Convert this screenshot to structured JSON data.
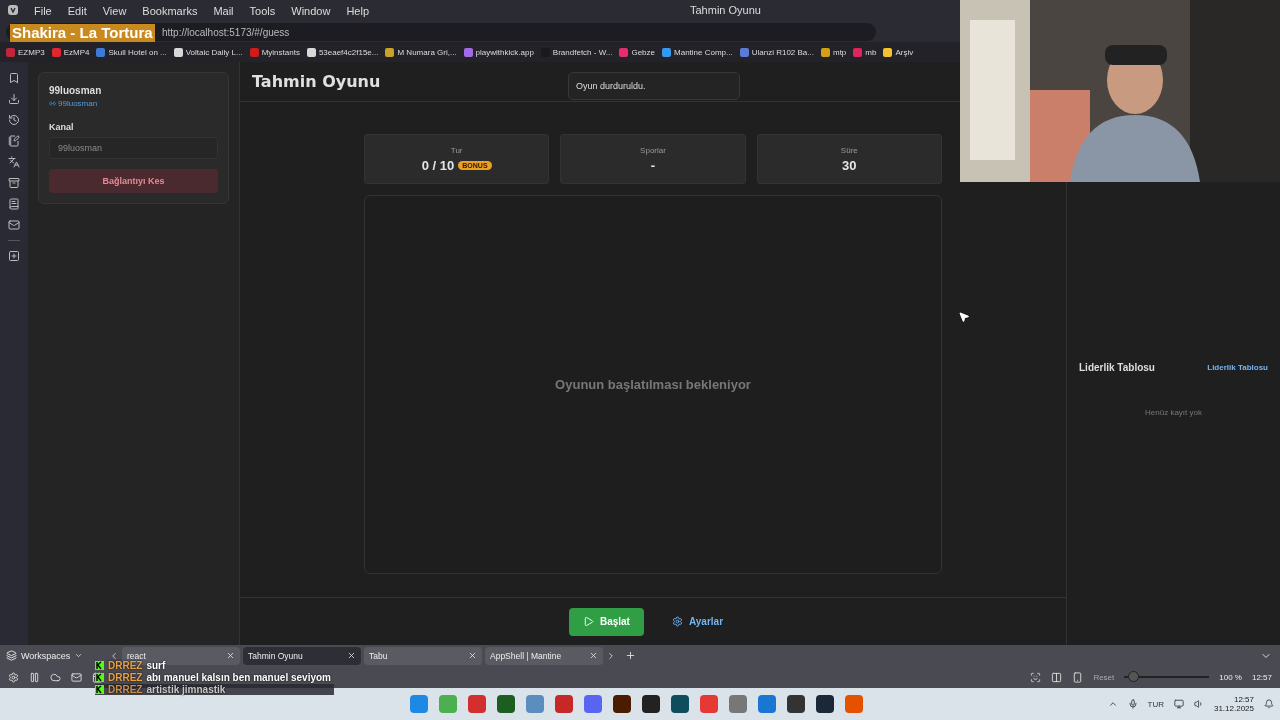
{
  "window": {
    "title": "Tahmin Oyunu"
  },
  "menu": [
    "File",
    "Edit",
    "View",
    "Bookmarks",
    "Mail",
    "Tools",
    "Window",
    "Help"
  ],
  "now_playing": "Shakira - La Tortura",
  "address": "http://localhost:5173/#/guess",
  "bookmarks": [
    {
      "label": "EZMP3",
      "color": "#c0263a"
    },
    {
      "label": "EzMP4",
      "color": "#e0262e"
    },
    {
      "label": "Skull Hotel on ...",
      "color": "#3d7bd6"
    },
    {
      "label": "Voltaic Daily L...",
      "color": "#d8d8d8"
    },
    {
      "label": "Myinstants",
      "color": "#d11a1a"
    },
    {
      "label": "53eaef4c2f15e...",
      "color": "#d8d8d8"
    },
    {
      "label": "M Numara Gri,...",
      "color": "#c9a227"
    },
    {
      "label": "playwithkick.app",
      "color": "#a16be8"
    },
    {
      "label": "Brandfetch - W...",
      "color": "#1a1a1a"
    },
    {
      "label": "Gebze",
      "color": "#e1306c"
    },
    {
      "label": "Mantine Comp...",
      "color": "#339af0"
    },
    {
      "label": "Ulanzi R102 Ba...",
      "color": "#5a7bd6"
    },
    {
      "label": "mtp",
      "color": "#d4a017"
    },
    {
      "label": "mb",
      "color": "#e0245e"
    },
    {
      "label": "Arşiv",
      "color": "#f2c230"
    }
  ],
  "connection": {
    "user": "99luosman",
    "link": "99luosman",
    "label": "Kanal",
    "placeholder": "99luosman",
    "button": "Bağlantıyı Kes"
  },
  "game": {
    "title": "Tahmin Oyunu",
    "toast": "Oyun durduruldu.",
    "stats": [
      {
        "label": "Tur",
        "value": "0 / 10",
        "badge": "BONUS"
      },
      {
        "label": "Sporlar",
        "value": "-"
      },
      {
        "label": "Süre",
        "value": "30"
      }
    ],
    "message": "Oyunun başlatılması bekleniyor",
    "actions": [
      {
        "label": "Başlat",
        "kind": "primary"
      },
      {
        "label": "Ayarlar",
        "kind": "subtle"
      }
    ]
  },
  "leaderboard": {
    "title": "Liderlik Tablosu",
    "link": "Liderlik Tablosu",
    "empty": "Henüz kayıt yok"
  },
  "tab_bar": {
    "workspaces": "Workspaces",
    "tabs": [
      {
        "label": "react",
        "selected": false
      },
      {
        "label": "Tahmin Oyunu",
        "selected": true
      },
      {
        "label": "Tabu",
        "selected": false
      },
      {
        "label": "AppShell | Mantine",
        "selected": false
      }
    ]
  },
  "status_bar": {
    "reset": "Reset",
    "zoom": {
      "level": 0.1
    },
    "zoom_reading": "100 %",
    "clock": "12:57"
  },
  "chat": [
    {
      "user": "DRREZ",
      "text": "surf",
      "faded": false
    },
    {
      "user": "DRREZ",
      "text": "abı manuel kalsın ben manuel seviyom",
      "faded": false
    },
    {
      "user": "DRREZ",
      "text": "artistik jimnastik",
      "faded": true
    }
  ],
  "taskbar": {
    "language": "TUR",
    "time": "12:57",
    "date": "31.12.2025"
  }
}
